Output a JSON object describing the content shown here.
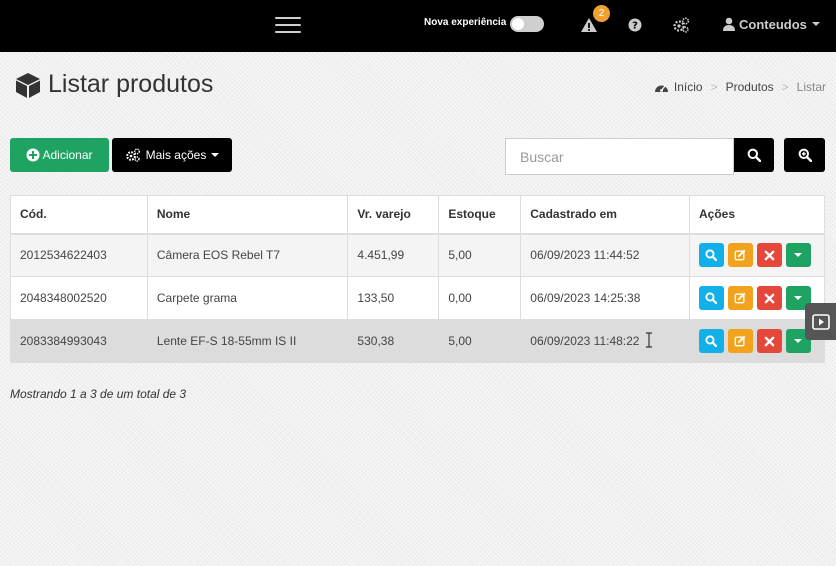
{
  "topbar": {
    "nova_experiencia_label": "Nova experiência",
    "alert_count": "2",
    "user_label": "Conteudos"
  },
  "page": {
    "title": "Listar produtos"
  },
  "breadcrumb": {
    "home": "Início",
    "section": "Produtos",
    "current": "Listar"
  },
  "toolbar": {
    "add_label": "Adicionar",
    "more_label": "Mais ações",
    "search_placeholder": "Buscar"
  },
  "table": {
    "headers": {
      "code": "Cód.",
      "name": "Nome",
      "price": "Vr. varejo",
      "stock": "Estoque",
      "created": "Cadastrado em",
      "actions": "Ações"
    },
    "rows": [
      {
        "code": "2012534622403",
        "name": "Câmera EOS Rebel T7",
        "price": "4.451,99",
        "stock": "5,00",
        "created": "06/09/2023 11:44:52"
      },
      {
        "code": "2048348002520",
        "name": "Carpete grama",
        "price": "133,50",
        "stock": "0,00",
        "created": "06/09/2023 14:25:38"
      },
      {
        "code": "2083384993043",
        "name": "Lente EF-S 18-55mm IS II",
        "price": "530,38",
        "stock": "5,00",
        "created": "06/09/2023 11:48:22"
      }
    ]
  },
  "footer": {
    "info": "Mostrando 1 a 3 de um total de 3"
  },
  "colors": {
    "topbar": "#000000",
    "add_button": "#1fa363",
    "view_action": "#12b0e8",
    "edit_action": "#f2a21c",
    "delete_action": "#e5473b",
    "more_action": "#1fa363",
    "alert_badge": "#f0a030"
  },
  "icons": {
    "menu": "hamburger-icon",
    "alert": "warning-icon",
    "help": "question-icon",
    "settings": "gears-icon",
    "user": "user-icon",
    "page": "cube-icon",
    "home": "dashboard-icon",
    "add": "plus-circle-icon",
    "more": "gears-icon",
    "search": "search-icon",
    "advanced_search": "zoom-in-icon",
    "view": "search-icon",
    "edit": "edit-icon",
    "delete": "close-icon",
    "row_more": "caret-down-icon",
    "side_tab": "play-icon"
  }
}
